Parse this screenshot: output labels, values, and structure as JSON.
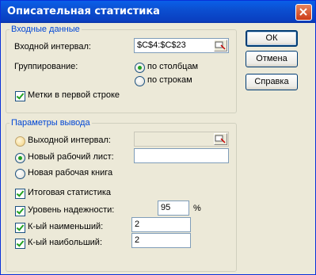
{
  "window": {
    "title": "Описательная статистика"
  },
  "input_group": {
    "legend": "Входные данные",
    "input_range_label": "Входной интервал:",
    "input_range_value": "$C$4:$C$23",
    "grouping_label": "Группирование:",
    "by_columns": "по столбцам",
    "by_rows": "по строкам",
    "labels_first_row": "Метки в первой строке"
  },
  "output_group": {
    "legend": "Параметры вывода",
    "output_range_label": "Выходной интервал:",
    "output_range_value": "",
    "new_sheet_label": "Новый рабочий лист:",
    "new_sheet_value": "",
    "new_book_label": "Новая рабочая книга",
    "summary_stats": "Итоговая статистика",
    "confidence_label": "Уровень надежности:",
    "confidence_value": "95",
    "confidence_unit": "%",
    "kth_smallest_label": "К-ый наименьший:",
    "kth_smallest_value": "2",
    "kth_largest_label": "К-ый наибольший:",
    "kth_largest_value": "2"
  },
  "buttons": {
    "ok": "ОК",
    "cancel": "Отмена",
    "help": "Справка"
  },
  "state": {
    "grouping": "columns",
    "output": "new_sheet",
    "labels_first_row": true,
    "summary_stats": true,
    "confidence": true,
    "kth_smallest": true,
    "kth_largest": true
  }
}
